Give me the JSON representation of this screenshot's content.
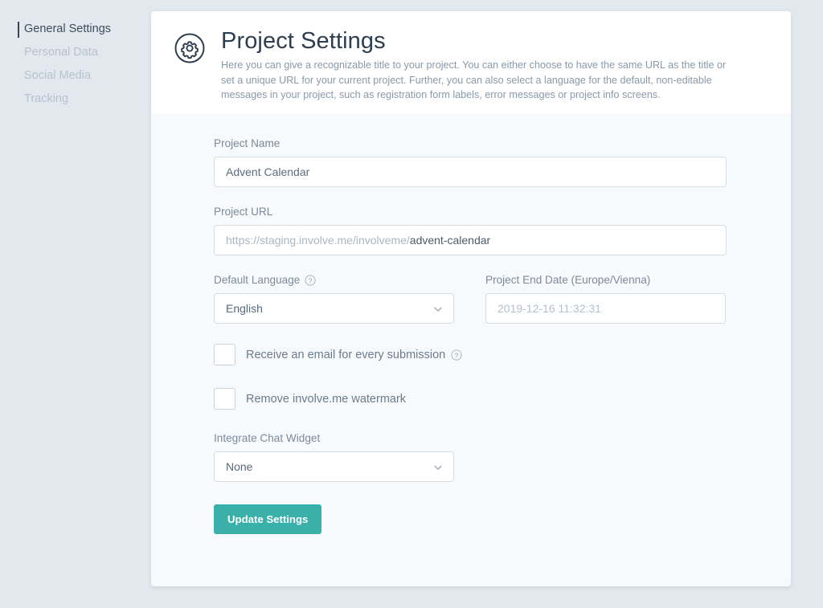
{
  "sidebar": {
    "items": [
      {
        "label": "General Settings",
        "active": true
      },
      {
        "label": "Personal Data",
        "active": false
      },
      {
        "label": "Social Media",
        "active": false
      },
      {
        "label": "Tracking",
        "active": false
      }
    ]
  },
  "header": {
    "icon": "gear-icon",
    "title": "Project Settings",
    "description": "Here you can give a recognizable title to your project. You can either choose to have the same URL as the title or set a unique URL for your current project. Further, you can also select a language for the default, non-editable messages in your project, such as registration form labels, error messages or project info screens."
  },
  "form": {
    "project_name": {
      "label": "Project Name",
      "value": "Advent Calendar"
    },
    "project_url": {
      "label": "Project URL",
      "prefix": "https://staging.involve.me/involveme/",
      "slug": "advent-calendar"
    },
    "default_language": {
      "label": "Default Language",
      "help_icon": "question-circle-icon",
      "value": "English",
      "options": [
        "English"
      ]
    },
    "project_end_date": {
      "label": "Project End Date (Europe/Vienna)",
      "placeholder": "2019-12-16 11:32:31",
      "value": ""
    },
    "receive_email": {
      "label": "Receive an email for every submission",
      "help_icon": "question-circle-icon",
      "checked": false
    },
    "remove_watermark": {
      "label": "Remove involve.me watermark",
      "checked": false
    },
    "chat_widget": {
      "label": "Integrate Chat Widget",
      "value": "None",
      "options": [
        "None"
      ]
    },
    "submit_label": "Update Settings"
  },
  "colors": {
    "page_background": "#e2e8ee",
    "card_background": "#f7fafc",
    "header_background": "#ffffff",
    "accent": "#39b0aa",
    "title_text": "#2d3e50",
    "muted_text": "#8a99a8",
    "sidebar_inactive": "#b6c2cf"
  }
}
